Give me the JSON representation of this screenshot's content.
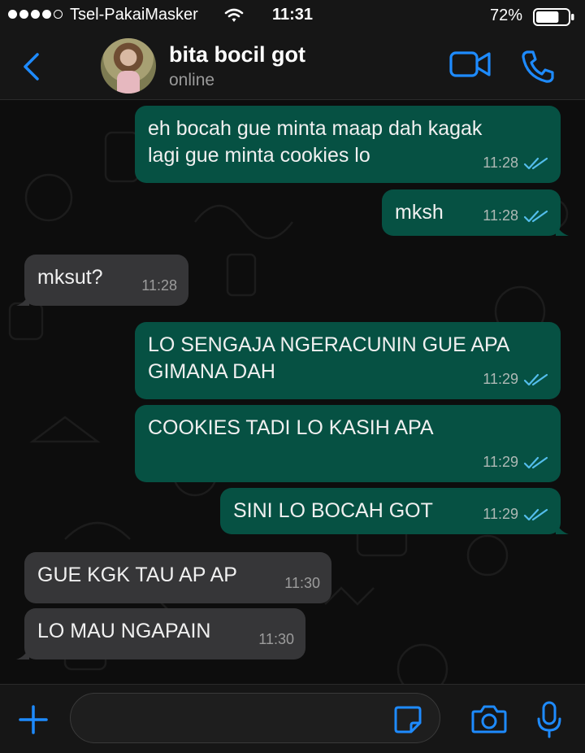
{
  "status_bar": {
    "carrier": "Tsel-PakaiMasker",
    "time": "11:31",
    "battery": "72%",
    "signal_bars": 4,
    "signal_max": 5,
    "battery_level": 0.72
  },
  "header": {
    "back_icon": "chevron-left-icon",
    "contact_name": "bita bocil got",
    "contact_status": "online",
    "video_call_icon": "video-camera-icon",
    "voice_call_icon": "phone-icon"
  },
  "messages": [
    {
      "direction": "out",
      "lines": [
        "eh bocah gue minta maap dah kagak",
        "lagi gue minta cookies lo"
      ],
      "time": "11:28",
      "read": true
    },
    {
      "direction": "out",
      "lines": [
        "mksh"
      ],
      "time": "11:28",
      "read": true
    },
    {
      "direction": "in",
      "lines": [
        "mksut?"
      ],
      "time": "11:28"
    },
    {
      "direction": "out",
      "lines": [
        "LO SENGAJA NGERACUNIN GUE APA",
        "GIMANA DAH"
      ],
      "time": "11:29",
      "read": true
    },
    {
      "direction": "out",
      "lines": [
        "COOKIES TADI LO KASIH APA"
      ],
      "time": "11:29",
      "read": true
    },
    {
      "direction": "out",
      "lines": [
        "SINI LO BOCAH GOT"
      ],
      "time": "11:29",
      "read": true
    },
    {
      "direction": "in",
      "lines": [
        "GUE KGK TAU AP AP"
      ],
      "time": "11:30"
    },
    {
      "direction": "in",
      "lines": [
        "LO MAU NGAPAIN"
      ],
      "time": "11:30"
    }
  ],
  "input_bar": {
    "attach_icon": "plus-icon",
    "message_value": "",
    "sticker_icon": "sticker-icon",
    "camera_icon": "camera-icon",
    "mic_icon": "microphone-icon"
  },
  "colors": {
    "accent": "#1e8bff",
    "outgoing_bubble": "#065143",
    "incoming_bubble": "#363638",
    "read_ticks": "#53bdeb"
  }
}
